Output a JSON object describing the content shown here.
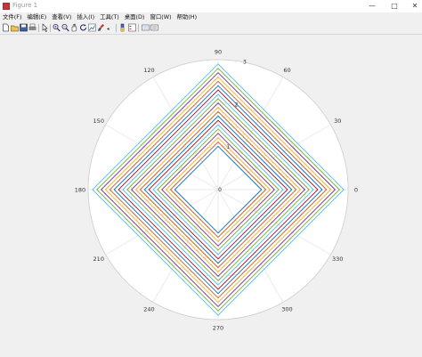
{
  "window": {
    "title": "Figure 1",
    "minimize_icon": "minimize-icon",
    "maximize_icon": "maximize-icon",
    "close_icon": "close-icon"
  },
  "menu": {
    "items": [
      "文件(F)",
      "编辑(E)",
      "查看(V)",
      "插入(I)",
      "工具(T)",
      "桌面(D)",
      "窗口(W)",
      "帮助(H)"
    ]
  },
  "toolbar": {
    "icons": [
      "new-figure-icon",
      "open-icon",
      "save-icon",
      "print-icon",
      "edit-plot-icon",
      "zoom-in-icon",
      "zoom-out-icon",
      "pan-icon",
      "rotate-icon",
      "data-cursor-icon",
      "brush-icon",
      "link-icon",
      "insert-colorbar-icon",
      "insert-legend-icon",
      "hide-plot-tools-icon",
      "show-plot-tools-icon"
    ]
  },
  "chart_data": {
    "type": "polar-line",
    "theta_ticks": [
      "0",
      "30",
      "60",
      "90",
      "120",
      "150",
      "180",
      "210",
      "240",
      "270",
      "300",
      "330"
    ],
    "r_ticks": [
      "0",
      "1",
      "2",
      "3"
    ],
    "rlim": [
      0,
      3
    ],
    "grid": true,
    "series": [
      {
        "color": "#0072BD",
        "r_vertex": 1.0
      },
      {
        "color": "#D95319",
        "r_vertex": 1.1
      },
      {
        "color": "#EDB120",
        "r_vertex": 1.2
      },
      {
        "color": "#7E2F8E",
        "r_vertex": 1.3
      },
      {
        "color": "#77AC30",
        "r_vertex": 1.4
      },
      {
        "color": "#4DBEEE",
        "r_vertex": 1.5
      },
      {
        "color": "#A2142F",
        "r_vertex": 1.6
      },
      {
        "color": "#0072BD",
        "r_vertex": 1.7
      },
      {
        "color": "#D95319",
        "r_vertex": 1.8
      },
      {
        "color": "#EDB120",
        "r_vertex": 1.9
      },
      {
        "color": "#7E2F8E",
        "r_vertex": 2.0
      },
      {
        "color": "#77AC30",
        "r_vertex": 2.1
      },
      {
        "color": "#4DBEEE",
        "r_vertex": 2.2
      },
      {
        "color": "#A2142F",
        "r_vertex": 2.3
      },
      {
        "color": "#0072BD",
        "r_vertex": 2.4
      },
      {
        "color": "#D95319",
        "r_vertex": 2.5
      },
      {
        "color": "#EDB120",
        "r_vertex": 2.6
      },
      {
        "color": "#7E2F8E",
        "r_vertex": 2.7
      },
      {
        "color": "#77AC30",
        "r_vertex": 2.8
      },
      {
        "color": "#4DBEEE",
        "r_vertex": 2.9
      }
    ]
  }
}
